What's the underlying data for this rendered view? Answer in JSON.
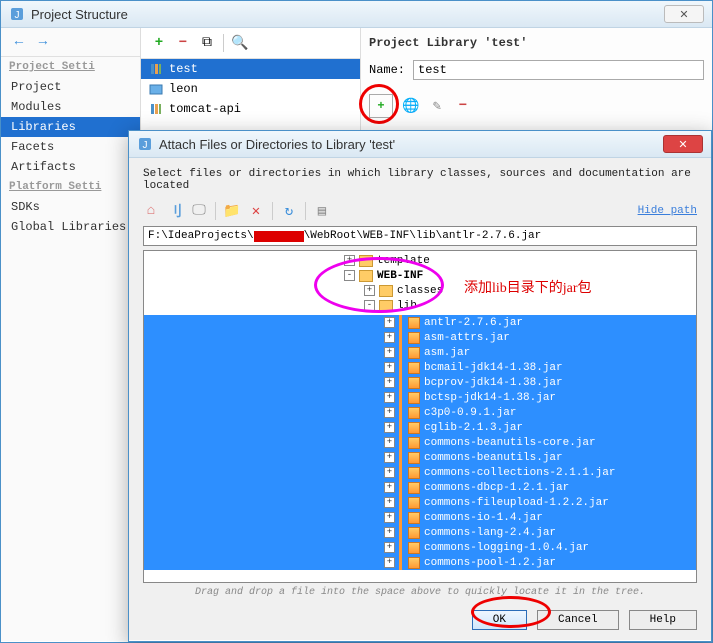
{
  "main": {
    "title": "Project Structure",
    "sidebar": {
      "section1": "Project Setti",
      "items1": [
        "Project",
        "Modules",
        "Libraries",
        "Facets",
        "Artifacts"
      ],
      "selected": 2,
      "section2": "Platform Setti",
      "items2": [
        "SDKs",
        "Global Libraries"
      ]
    },
    "libs": {
      "items": [
        {
          "name": "test",
          "kind": "lib"
        },
        {
          "name": "leon",
          "kind": "module"
        },
        {
          "name": "tomcat-api",
          "kind": "lib"
        }
      ],
      "selected": 0
    },
    "right": {
      "title": "Project Library 'test'",
      "name_label": "Name:",
      "name_value": "test"
    }
  },
  "dialog": {
    "title": "Attach Files or Directories to Library 'test'",
    "instruction": "Select files or directories in which library classes, sources and documentation are located",
    "hide_path": "Hide path",
    "path": "F:\\IdeaProjects\\        \\WebRoot\\WEB-INF\\lib\\antlr-2.7.6.jar",
    "path_prefix": "F:\\IdeaProjects\\",
    "path_suffix": "\\WebRoot\\WEB-INF\\lib\\antlr-2.7.6.jar",
    "tree_top": [
      {
        "name": "template",
        "depth": 5,
        "exp": "+"
      },
      {
        "name": "WEB-INF",
        "depth": 5,
        "exp": "-",
        "bold": true
      },
      {
        "name": "classes",
        "depth": 6,
        "exp": "+"
      },
      {
        "name": "lib",
        "depth": 6,
        "exp": "-"
      }
    ],
    "jars": [
      "antlr-2.7.6.jar",
      "asm-attrs.jar",
      "asm.jar",
      "bcmail-jdk14-1.38.jar",
      "bcprov-jdk14-1.38.jar",
      "bctsp-jdk14-1.38.jar",
      "c3p0-0.9.1.jar",
      "cglib-2.1.3.jar",
      "commons-beanutils-core.jar",
      "commons-beanutils.jar",
      "commons-collections-2.1.1.jar",
      "commons-dbcp-1.2.1.jar",
      "commons-fileupload-1.2.2.jar",
      "commons-io-1.4.jar",
      "commons-lang-2.4.jar",
      "commons-logging-1.0.4.jar",
      "commons-pool-1.2.jar"
    ],
    "drag_hint": "Drag and drop a file into the space above to quickly locate it in the tree.",
    "buttons": {
      "ok": "OK",
      "cancel": "Cancel",
      "help": "Help"
    }
  },
  "annotation": "添加lib目录下的jar包"
}
